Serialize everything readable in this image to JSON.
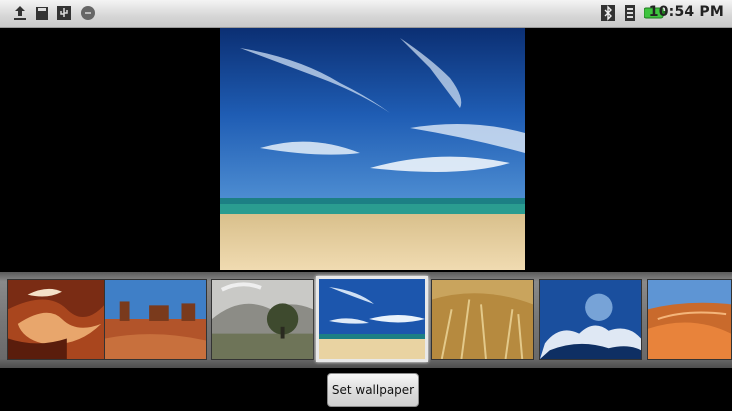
{
  "status_bar": {
    "left_icons": [
      "upload-icon",
      "sd-card-icon",
      "usb-icon",
      "notification-dot-icon"
    ],
    "right_icons": [
      "bluetooth-icon",
      "signal-icon",
      "battery-icon"
    ],
    "time": "10:54 PM",
    "battery_color": "#3fc43f"
  },
  "preview": {
    "image": "beach-sky-wallpaper"
  },
  "gallery": {
    "thumbnails": [
      {
        "image": "canyon-wallpaper",
        "selected": false
      },
      {
        "image": "desert-buttes-wallpaper",
        "selected": false
      },
      {
        "image": "tree-hills-wallpaper",
        "selected": false
      },
      {
        "image": "beach-sky-wallpaper",
        "selected": true
      },
      {
        "image": "wheat-field-wallpaper",
        "selected": false
      },
      {
        "image": "clouds-sky-wallpaper",
        "selected": false
      },
      {
        "image": "sand-dunes-wallpaper",
        "selected": false
      }
    ]
  },
  "actions": {
    "set_wallpaper_label": "Set wallpaper"
  }
}
